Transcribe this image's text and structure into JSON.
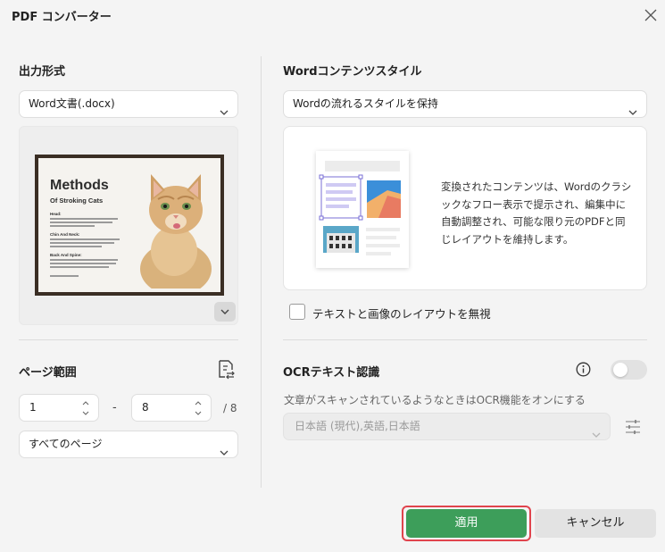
{
  "dialog": {
    "title": "PDF コンバーター"
  },
  "output_format": {
    "label": "出力形式",
    "selected": "Word文書(.docx)"
  },
  "preview": {
    "title": "Methods",
    "subtitle": "Of Stroking Cats",
    "headings": [
      "Head:",
      "Chin And Neck:",
      "Back And Spine:"
    ]
  },
  "page_range": {
    "label": "ページ範囲",
    "from": "1",
    "dash": "-",
    "to": "8",
    "total": "/ 8",
    "scope": "すべてのページ"
  },
  "word_style": {
    "label": "Wordコンテンツスタイル",
    "selected": "Wordの流れるスタイルを保持",
    "description": "変換されたコンテンツは、Wordのクラシックなフロー表示で提示され、編集中に自動調整され、可能な限り元のPDFと同じレイアウトを維持します。",
    "ignore_layout_label": "テキストと画像のレイアウトを無視",
    "ignore_layout_checked": false
  },
  "ocr": {
    "label": "OCRテキスト認識",
    "enabled": false,
    "description": "文章がスキャンされているようなときはOCR機能をオンにする",
    "languages": "日本語 (現代),英語,日本語"
  },
  "buttons": {
    "apply": "適用",
    "cancel": "キャンセル"
  },
  "colors": {
    "accent_green": "#3d9e5a",
    "highlight_red": "#e0444d",
    "selection_purple": "#7a6fd6"
  },
  "icons": [
    "close-icon",
    "chevron-down-icon",
    "expand-icon",
    "page-range-icon",
    "spinner-arrows-icon",
    "info-icon",
    "sliders-icon"
  ]
}
